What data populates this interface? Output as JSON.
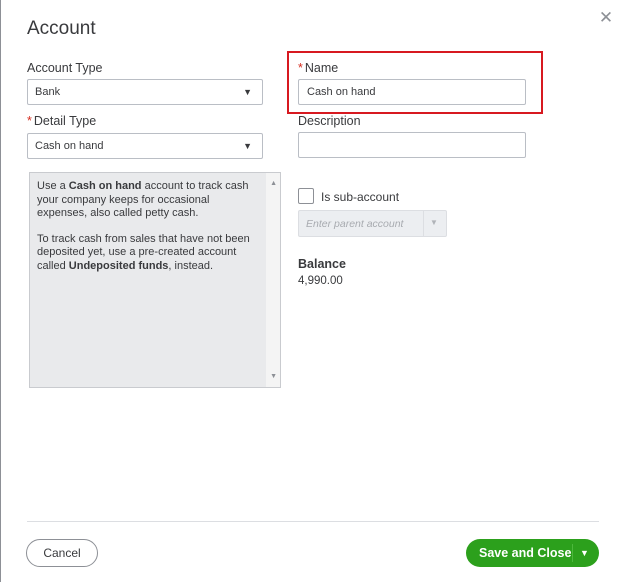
{
  "dialog": {
    "title": "Account",
    "close_symbol": "✕"
  },
  "form": {
    "account_type": {
      "label": "Account Type",
      "value": "Bank"
    },
    "name": {
      "required_mark": "*",
      "label": "Name",
      "value": "Cash on hand"
    },
    "detail_type": {
      "required_mark": "*",
      "label": "Detail Type",
      "value": "Cash on hand"
    },
    "description": {
      "label": "Description",
      "value": ""
    },
    "info": {
      "p1_a": "Use a ",
      "p1_b": "Cash on hand",
      "p1_c": " account to track cash your company keeps for occasional expenses, also called petty cash.",
      "p2_a": "To track cash from sales that have not been deposited yet, use a pre-created account called ",
      "p2_b": "Undeposited funds",
      "p2_c": ", instead."
    },
    "sub_account": {
      "label": "Is sub-account",
      "checked": false
    },
    "parent_account": {
      "placeholder": "Enter parent account"
    },
    "balance": {
      "label": "Balance",
      "value": "4,990.00"
    }
  },
  "footer": {
    "cancel_label": "Cancel",
    "save_label": "Save and Close"
  },
  "icons": {
    "caret_down": "▼",
    "caret_up": "▲",
    "close": "close-icon"
  },
  "colors": {
    "primary_green": "#2ca01c",
    "highlight_red": "#d71920",
    "required_red": "#d52b1e"
  }
}
